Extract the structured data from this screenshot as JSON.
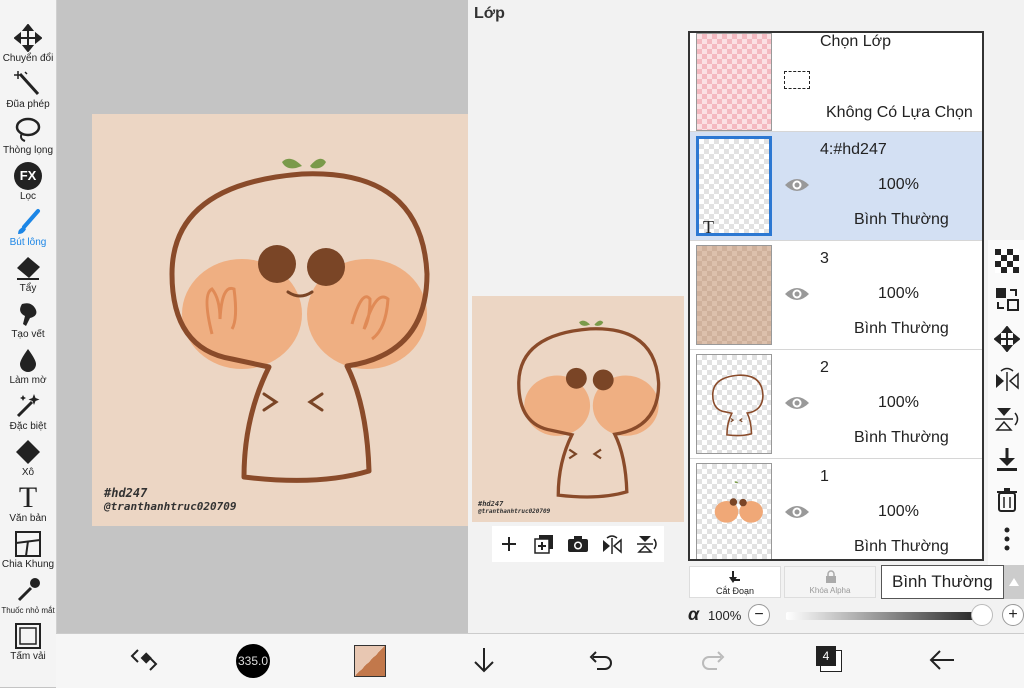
{
  "toolbar": {
    "tools": [
      {
        "label": "Chuyển đổi",
        "icon": "move-icon"
      },
      {
        "label": "Đũa phép",
        "icon": "magic-wand-icon"
      },
      {
        "label": "Thòng lọng",
        "icon": "lasso-icon"
      },
      {
        "label": "Lọc",
        "icon": "fx-icon",
        "icon_text": "FX"
      },
      {
        "label": "Bút lông",
        "icon": "brush-icon",
        "active": true
      },
      {
        "label": "Tẩy",
        "icon": "eraser-icon"
      },
      {
        "label": "Tạo vết",
        "icon": "smudge-icon"
      },
      {
        "label": "Làm mờ",
        "icon": "blur-drop-icon"
      },
      {
        "label": "Đặc biệt",
        "icon": "sparkle-icon"
      },
      {
        "label": "Xô",
        "icon": "bucket-icon"
      },
      {
        "label": "Văn bản",
        "icon": "text-icon",
        "icon_text": "T"
      },
      {
        "label": "Chia Khung",
        "icon": "frame-divider-icon"
      },
      {
        "label": "Thuốc nhỏ mắt",
        "icon": "eyedropper-icon"
      },
      {
        "label": "Tấm vải",
        "icon": "canvas-icon"
      }
    ]
  },
  "canvas": {
    "watermark_line1": "#hd247",
    "watermark_line2": "@tranthanhtruc020709"
  },
  "panel": {
    "title": "Lớp",
    "selection_layer": {
      "title": "Chọn Lớp",
      "status": "Không Có Lựa Chọn"
    },
    "layers": [
      {
        "name": "4:#hd247",
        "opacity": "100%",
        "mode": "Bình Thường",
        "selected": true
      },
      {
        "name": "3",
        "opacity": "100%",
        "mode": "Bình Thường"
      },
      {
        "name": "2",
        "opacity": "100%",
        "mode": "Bình Thường"
      },
      {
        "name": "1",
        "opacity": "100%",
        "mode": "Bình Thường"
      }
    ],
    "thumb_text_glyph": "T"
  },
  "options": {
    "clip_label": "Cắt Đoạn",
    "alpha_lock_label": "Khóa Alpha",
    "blend_mode": "Bình Thường",
    "alpha_symbol": "α",
    "opacity": "100%",
    "opacity_fraction": 1.0
  },
  "bottombar": {
    "brush_size": "335.0",
    "layer_count": "4"
  },
  "colors": {
    "accent": "#1c86e6",
    "canvas_bg": "#ecd6c4",
    "stroke": "#8a4b2a",
    "cheek": "#f0a877",
    "selected_layer": "#d3e0f3"
  }
}
